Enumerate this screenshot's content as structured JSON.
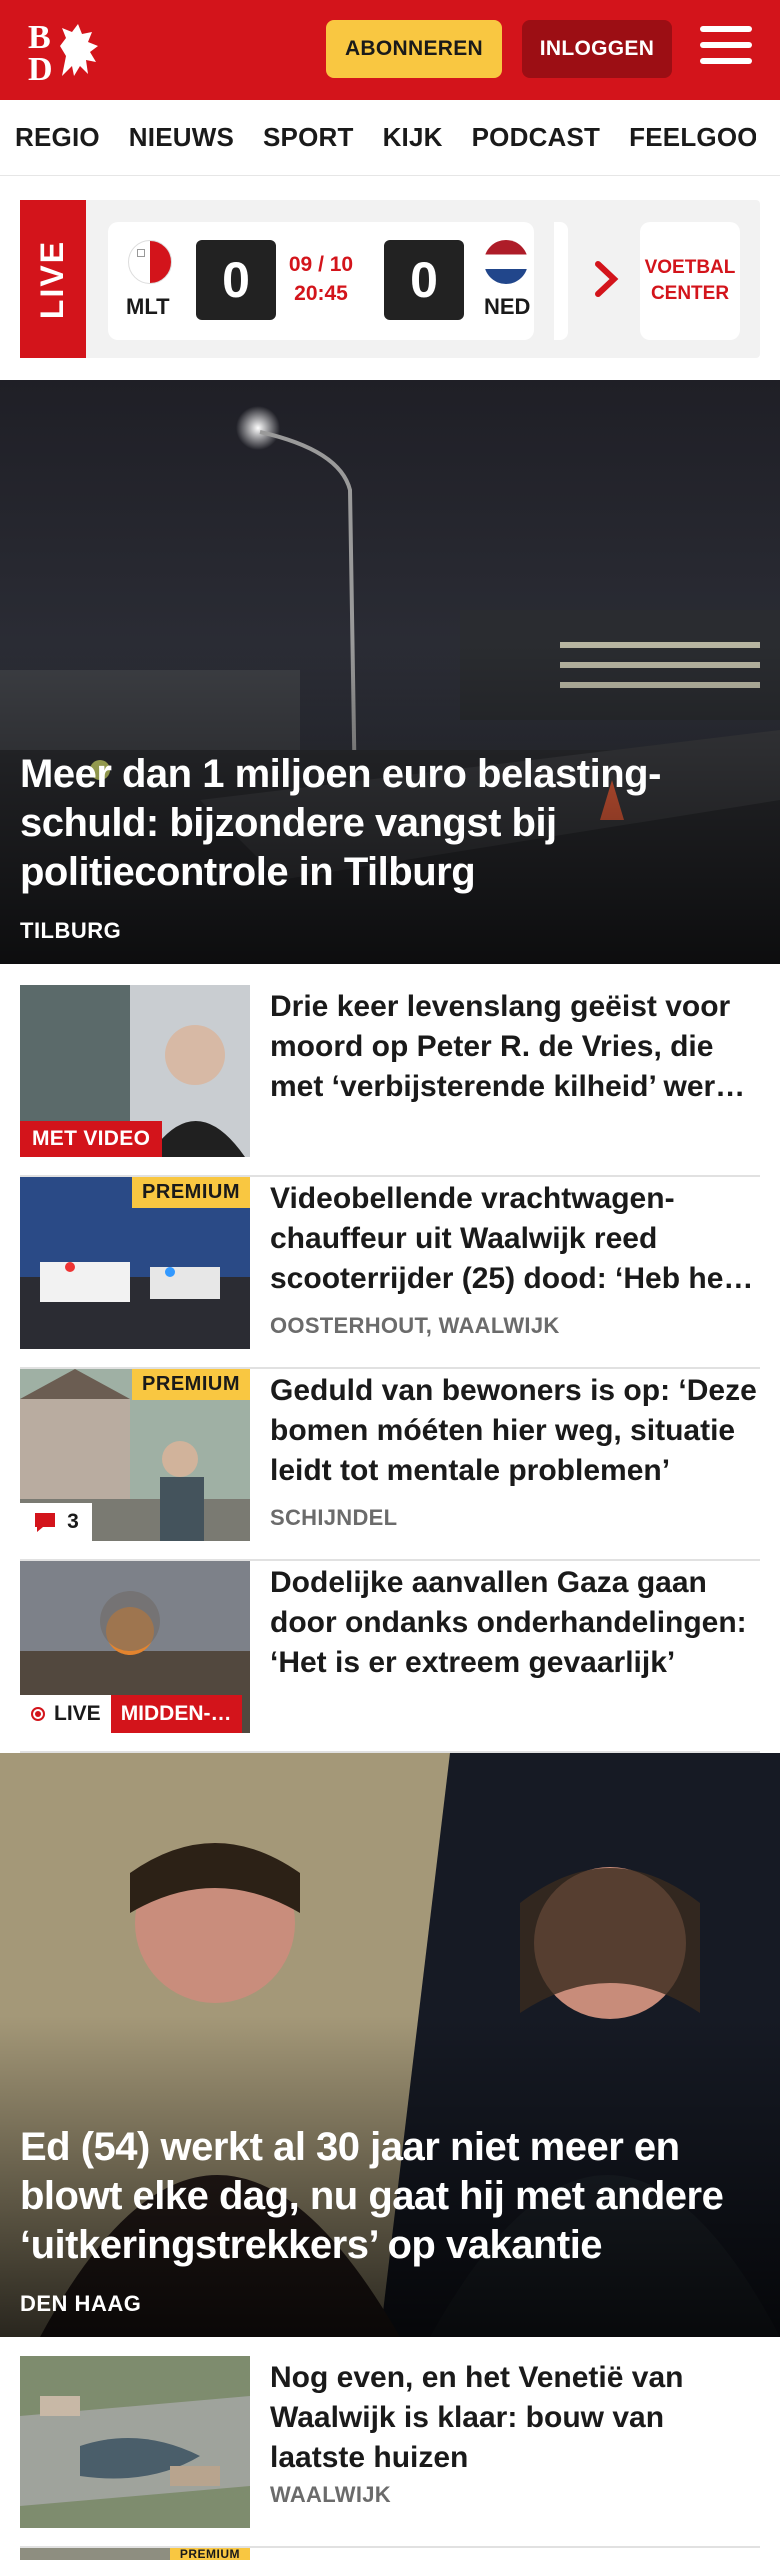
{
  "header": {
    "logo_text": "BD",
    "subscribe_label": "ABONNEREN",
    "login_label": "INLOGGEN"
  },
  "nav": {
    "items": [
      "REGIO",
      "NIEUWS",
      "SPORT",
      "KIJK",
      "PODCAST",
      "FEELGOOD"
    ]
  },
  "live_scores": {
    "live_label": "LIVE",
    "home_team": "MLT",
    "home_score": "0",
    "away_team": "NED",
    "away_score": "0",
    "date": "09 / 10",
    "time": "20:45",
    "voetbal_center": "VOETBAL CENTER"
  },
  "hero1": {
    "title": "Meer dan 1 miljoen euro belasting-schuld: bijzondere vangst bij politiecontrole in Tilburg",
    "location": "TILBURG"
  },
  "articles": [
    {
      "title": "Drie keer levenslang geëist voor moord op Peter R. de Vries, die met ‘verbijsterende kilheid’ wer…",
      "location": "",
      "badge": "MET VIDEO"
    },
    {
      "title": "Videobellende vrachtwagen-chauffeur uit Waalwijk reed scooterrijder (25) dood: ‘Heb he…",
      "location": "OOSTERHOUT, WAALWIJK",
      "badge": "PREMIUM"
    },
    {
      "title": "Geduld van bewoners is op: ‘Deze bomen móéten hier weg, situatie leidt tot mentale problemen’",
      "location": "SCHIJNDEL",
      "badge": "PREMIUM",
      "comments": "3"
    },
    {
      "title": "Dodelijke aanvallen Gaza gaan door ondanks onderhandelingen: ‘Het is er extreem gevaarlijk’",
      "location": "",
      "live_label": "LIVE",
      "section": "MIDDEN-…"
    }
  ],
  "hero2": {
    "title": "Ed (54) werkt al 30 jaar niet meer en blowt elke dag, nu gaat hij met andere ‘uitkeringstrekkers’ op vakantie",
    "location": "DEN HAAG"
  },
  "article5": {
    "title": "Nog even, en het Venetië van Waalwijk is klaar: bouw van laatste huizen",
    "location": "WAALWIJK"
  },
  "article6": {
    "badge": "PREMIUM"
  },
  "colors": {
    "brand_red": "#d3141b",
    "premium_yellow": "#f9c741"
  }
}
